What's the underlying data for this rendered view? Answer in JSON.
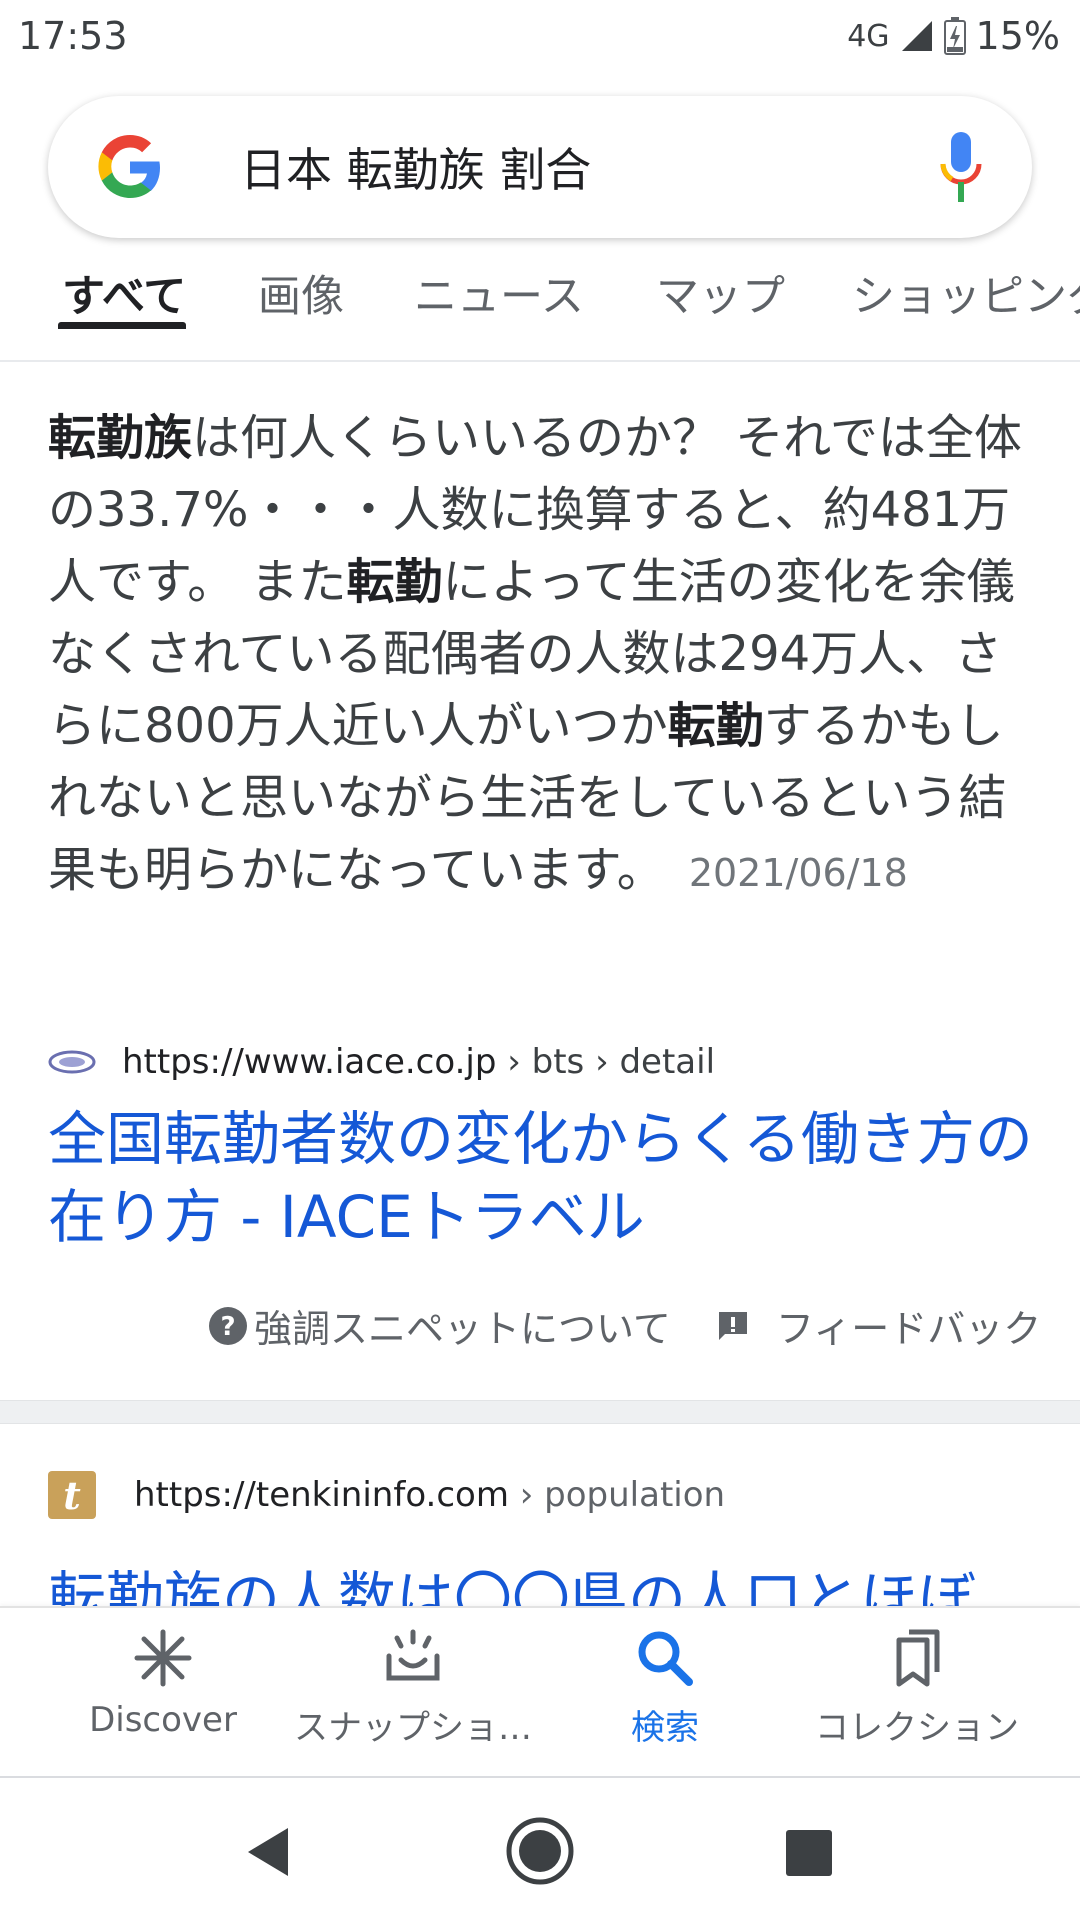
{
  "status_bar": {
    "time": "17:53",
    "network": "4G",
    "battery": "15%"
  },
  "search": {
    "query": "日本 転勤族 割合"
  },
  "tabs": [
    {
      "label": "すべて",
      "active": true
    },
    {
      "label": "画像"
    },
    {
      "label": "ニュース"
    },
    {
      "label": "マップ"
    },
    {
      "label": "ショッピング"
    }
  ],
  "snippet": {
    "bold_text": "転勤族",
    "text": "は何人くらいいるのか？ それでは全体の33.7%・・・人数に換算すると、約481万人です。 また",
    "bold_text2": "転勤",
    "text2": "によって生活の変化を余儀なくされている配偶者の人数は294万人、さらに800万人近い人がいつか",
    "bold_text3": "転勤",
    "text3": "するかもしれないと思いながら生活をしているという結果も明らかになっています。",
    "date": "2021/06/18"
  },
  "result1": {
    "url": "https://www.iace.co.jp",
    "breadcrumb": " › bts › detail",
    "title": "全国転勤者数の変化からくる働き方の在り方 - IACEトラベル"
  },
  "feedback": {
    "about_label": "強調スニペットについて",
    "feedback_label": "フィードバック"
  },
  "result2": {
    "favicon_letter": "t",
    "url": "https://tenkininfo.com",
    "breadcrumb": " › population",
    "title": "転勤族の人数は〇〇県の人口とほぼ"
  },
  "bottom_nav": [
    {
      "label": "Discover",
      "icon": "asterisk-icon"
    },
    {
      "label": "スナップショ…",
      "icon": "snapshot-icon"
    },
    {
      "label": "検索",
      "icon": "search-icon",
      "active": true
    },
    {
      "label": "コレクション",
      "icon": "collections-icon"
    }
  ],
  "colors": {
    "link": "#1558d6",
    "active_nav": "#1a73e8",
    "text": "#3c4043"
  }
}
